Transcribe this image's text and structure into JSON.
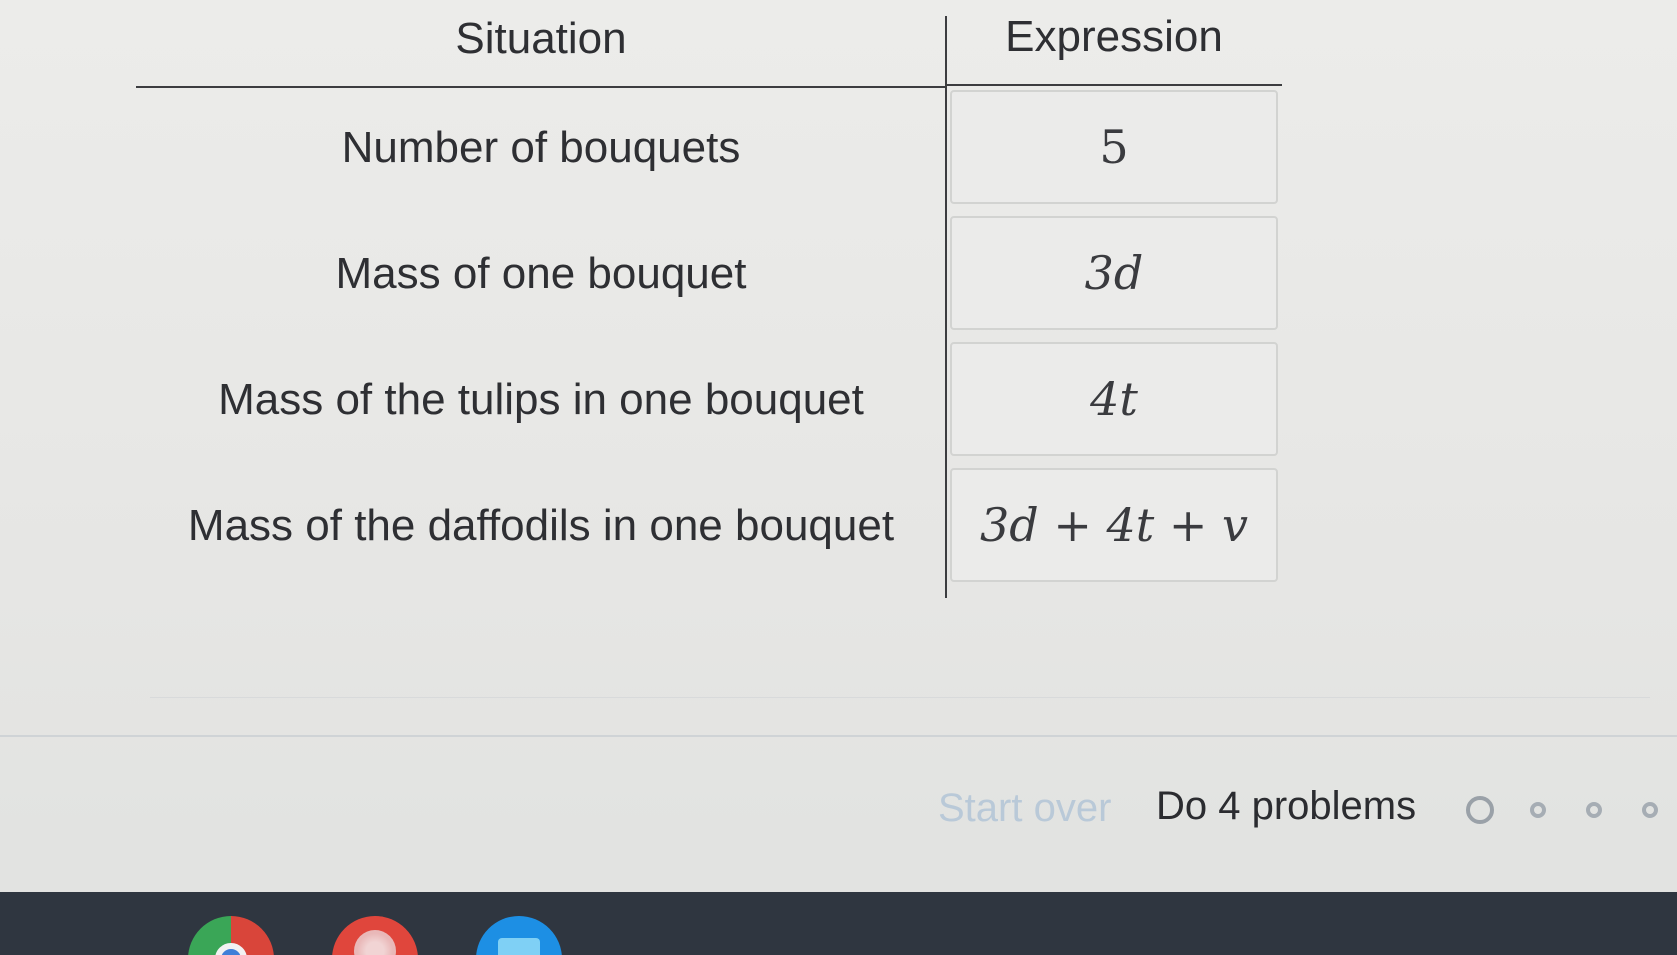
{
  "table": {
    "header_situation": "Situation",
    "header_expression": "Expression",
    "rows": [
      {
        "situation": "Number of bouquets",
        "expression": "5"
      },
      {
        "situation": "Mass of one bouquet",
        "expression": "3d"
      },
      {
        "situation": "Mass of the tulips in one bouquet",
        "expression": "4t"
      },
      {
        "situation": "Mass of the daffodils in one bouquet",
        "expression": "3d + 4t + v"
      }
    ]
  },
  "footer": {
    "start_over_label": "Start over",
    "goal_text": "Do 4 problems",
    "progress_total": 4,
    "progress_completed": 0
  },
  "taskbar": {
    "apps": [
      "chrome-icon",
      "app-icon",
      "files-icon"
    ]
  },
  "colors": {
    "start_over_link": "#b9c9d8",
    "taskbar_bg": "#2f3640",
    "text": "#2e2f33"
  }
}
